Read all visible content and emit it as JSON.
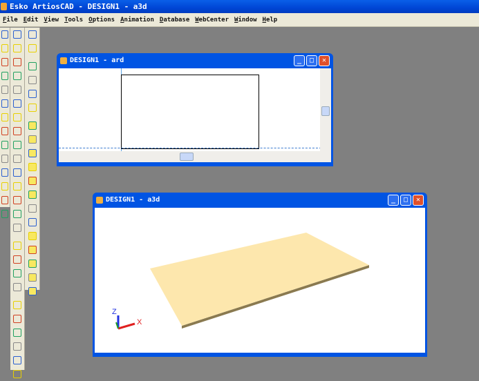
{
  "app": {
    "title": "Esko ArtiosCAD - DESIGN1 - a3d"
  },
  "menu": [
    "File",
    "Edit",
    "View",
    "Tools",
    "Options",
    "Animation",
    "Database",
    "WebCenter",
    "Window",
    "Help"
  ],
  "toolbars": {
    "col1": [
      "zoom-in",
      "zoom-window",
      "zoom-out",
      "zoom-fit",
      "zoom-detail",
      "pan",
      "view-eye",
      "dimension",
      "dimension-2",
      "rotate",
      "view-box",
      "fold",
      "light",
      "view-eye-2"
    ],
    "col2": [
      "select",
      "select-flag",
      "grid-1",
      "grid-2",
      "grid-3",
      "grid-4",
      "grid-5",
      "pencil",
      "pencil-square",
      "rotate-blue",
      "rotate-small",
      "arc",
      "clip",
      "clip-star",
      "clip-x",
      "spacer",
      "measure-h",
      "measure-diag",
      "measure-3",
      "measure-4",
      "spacer",
      "stack-red",
      "stack-2",
      "stack-3",
      "stack-4",
      "stack-5",
      "stack-6"
    ],
    "col3": [
      "orbit",
      "no-orbit",
      "spacer",
      "cyan-box",
      "curve",
      "rect-select",
      "move",
      "spacer",
      "solid-cube",
      "cube-2",
      "cube-3",
      "cube-wire",
      "cube-wire2",
      "cube-check",
      "bar",
      "paint",
      "cube-flat",
      "cube-red",
      "cube-grid",
      "cube-set",
      "cube-paint"
    ]
  },
  "windows": {
    "ard": {
      "title": "DESIGN1 - ard"
    },
    "a3d": {
      "title": "DESIGN1 - a3d",
      "axes": {
        "z": "Z",
        "x": "X"
      }
    }
  },
  "colors": {
    "board": "#fde7ad",
    "board_edge": "#8a7a50",
    "axis_x": "#e02020",
    "axis_z": "#2030e0",
    "axis_y": "#20a020"
  }
}
